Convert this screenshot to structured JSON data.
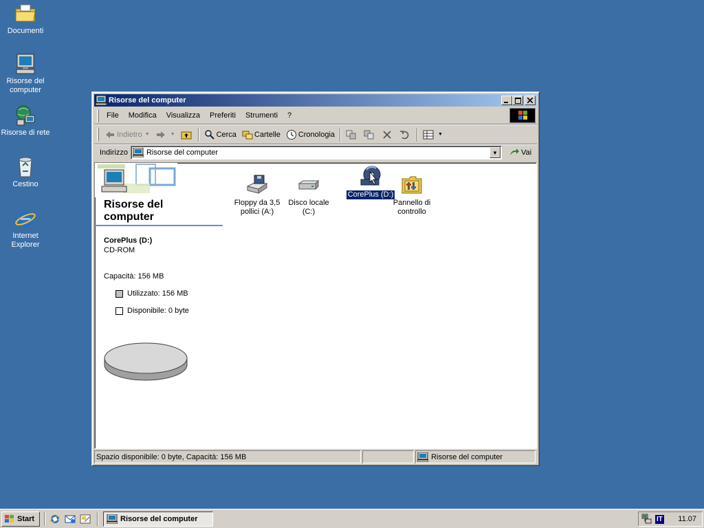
{
  "desktop": {
    "icons": [
      {
        "label": "Documenti"
      },
      {
        "label": "Risorse del computer"
      },
      {
        "label": "Risorse di rete"
      },
      {
        "label": "Cestino"
      },
      {
        "label": "Internet Explorer"
      }
    ]
  },
  "window": {
    "title": "Risorse del computer",
    "controls": {
      "minimize": "_",
      "maximize": "□",
      "close": "✕"
    },
    "menu": [
      "File",
      "Modifica",
      "Visualizza",
      "Preferiti",
      "Strumenti",
      "?"
    ],
    "toolbar": {
      "back": "Indietro",
      "search": "Cerca",
      "folders": "Cartelle",
      "history": "Cronologia"
    },
    "address": {
      "label": "Indirizzo",
      "value": "Risorse del computer",
      "go": "Vai"
    },
    "left_panel": {
      "title": "Risorse del computer",
      "drive_name": "CorePlus (D:)",
      "drive_type": "CD-ROM",
      "capacity": "Capacità: 156 MB",
      "used": "Utilizzato: 156 MB",
      "free": "Disponibile: 0 byte",
      "used_fraction": 1.0,
      "used_color": "#c0c0c0",
      "free_color": "#ffffff"
    },
    "items": [
      {
        "label": "Floppy da 3,5 pollici (A:)",
        "icon": "floppy-drive-icon"
      },
      {
        "label": "Disco locale (C:)",
        "icon": "hard-disk-icon"
      },
      {
        "label": "CorePlus (D:)",
        "icon": "cd-drive-icon",
        "selected": true
      },
      {
        "label": "Pannello di controllo",
        "icon": "control-panel-icon"
      }
    ],
    "status": {
      "left": "Spazio disponibile: 0 byte, Capacità: 156 MB",
      "middle": "",
      "right": "Risorse del computer"
    }
  },
  "taskbar": {
    "start": "Start",
    "task": "Risorse del computer",
    "lang": "IT",
    "clock": "11.07"
  },
  "colors": {
    "desktop": "#3a6ea5",
    "title_active_start": "#0a246a",
    "title_active_end": "#a6caf0",
    "face": "#d4d0c8",
    "selection": "#0a246a"
  }
}
